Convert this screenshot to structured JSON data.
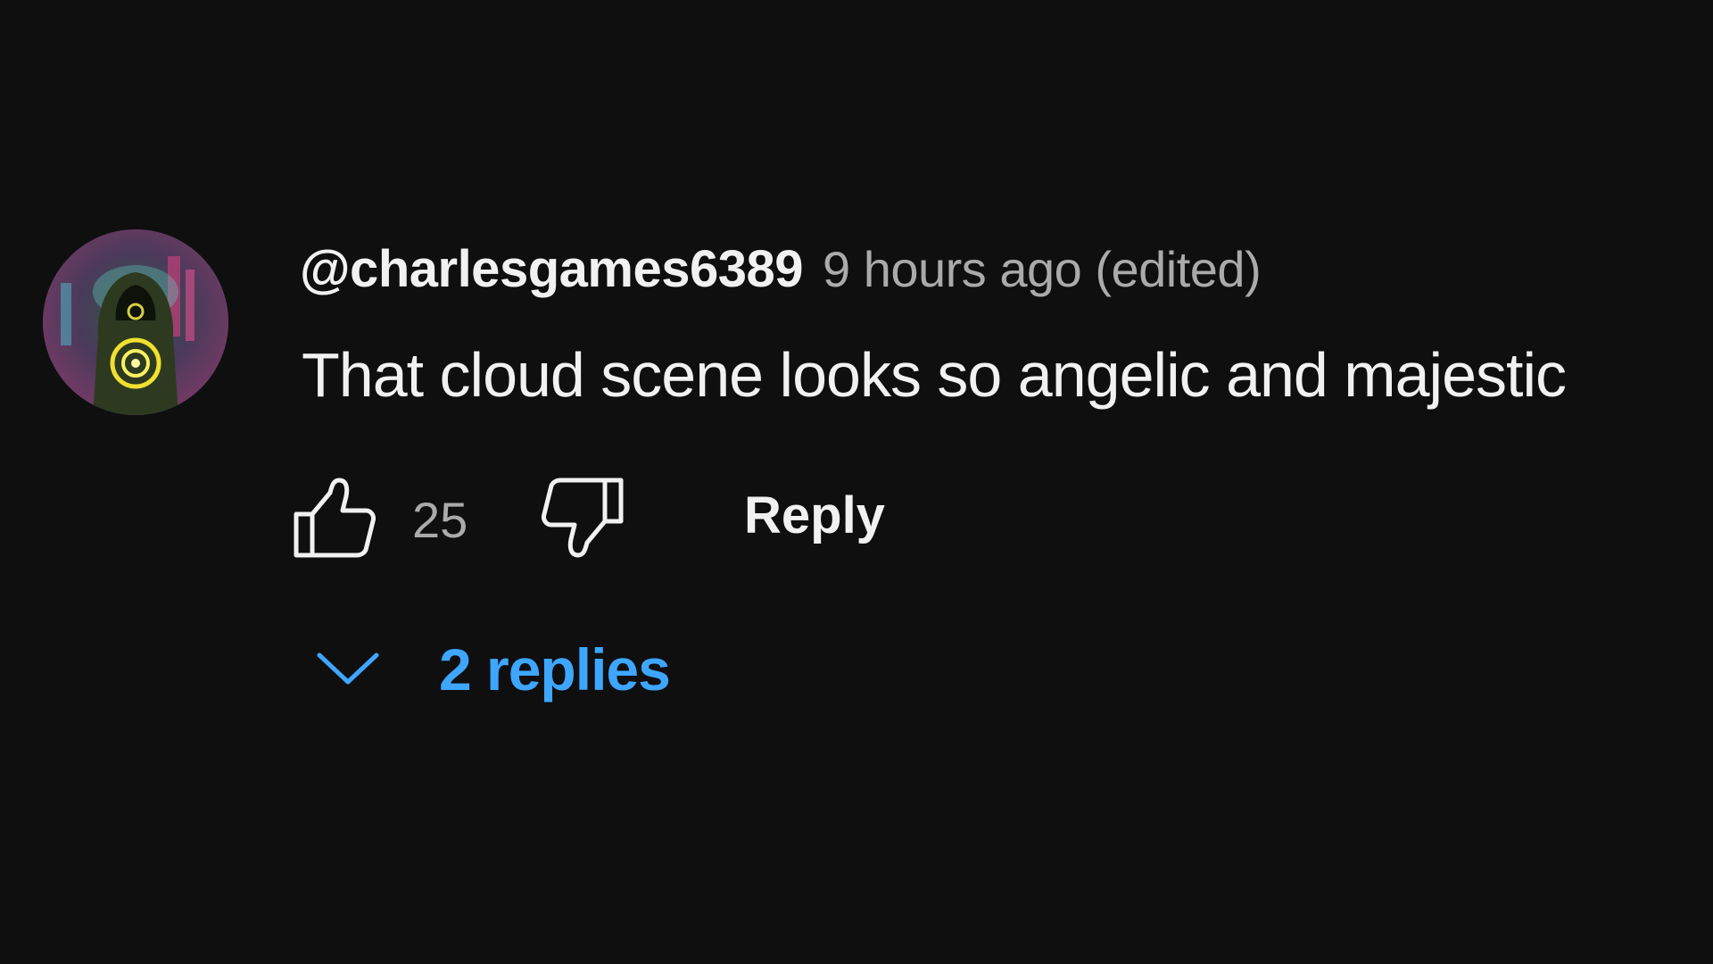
{
  "comment": {
    "avatar_icon": "hooded-figure-avatar",
    "username": "@charlesgames6389",
    "timestamp": "9 hours ago (edited)",
    "text": "That cloud scene looks so angelic and majestic",
    "like_count": "25",
    "reply_label": "Reply",
    "replies_label": "2 replies"
  },
  "colors": {
    "background": "#0f0f10",
    "primary_text": "#f1f1f1",
    "secondary_text": "#aaaaaa",
    "link_blue": "#3ea6ff"
  },
  "icons": {
    "like": "thumbs-up-icon",
    "dislike": "thumbs-down-icon",
    "expand": "chevron-down-icon"
  }
}
